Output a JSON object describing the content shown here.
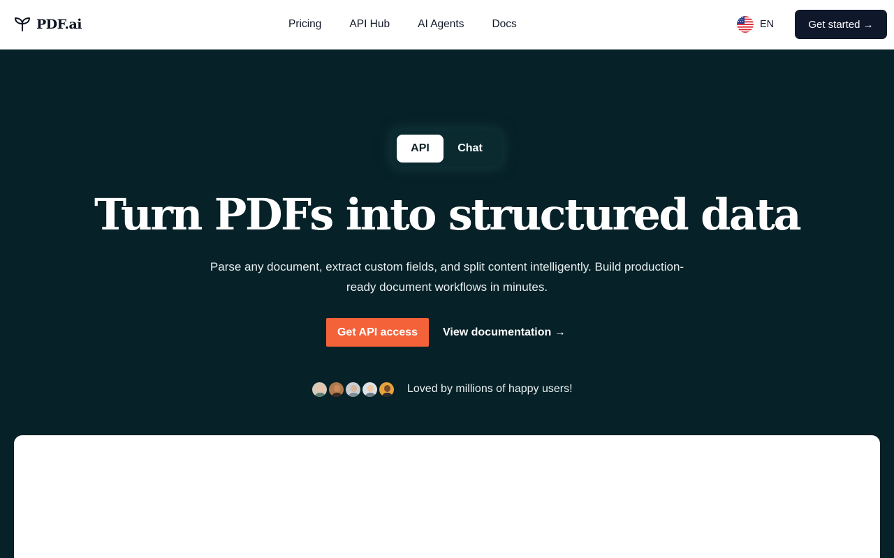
{
  "header": {
    "logo_text": "PDF.ai",
    "nav": [
      {
        "label": "Pricing"
      },
      {
        "label": "API Hub"
      },
      {
        "label": "AI Agents"
      },
      {
        "label": "Docs"
      }
    ],
    "language": "EN",
    "cta_label": "Get started →"
  },
  "hero": {
    "toggle": {
      "active": "API",
      "inactive": "Chat"
    },
    "headline": "Turn PDFs into structured data",
    "subheadline": "Parse any document, extract custom fields, and split content intelligently. Build production-ready document workflows in minutes.",
    "primary_button": "Get API access",
    "secondary_link": "View documentation →",
    "social_proof": "Loved by millions of happy users!"
  },
  "colors": {
    "background": "#062127",
    "accent": "#f4623a",
    "header_button": "#0f172a"
  },
  "avatars": [
    {
      "skin": "#e9c4a8",
      "clothes": "#5a7d72",
      "bg": "#d8c9b8"
    },
    {
      "skin": "#c88a5e",
      "clothes": "#3a2a22",
      "bg": "#b07a4c"
    },
    {
      "skin": "#d7b39a",
      "clothes": "#7d8c99",
      "bg": "#c9ced3"
    },
    {
      "skin": "#efc9a6",
      "clothes": "#6b7b86",
      "bg": "#dde2e6"
    },
    {
      "skin": "#7a4a2e",
      "clothes": "#2a2a2a",
      "bg": "#e8a23a"
    }
  ]
}
